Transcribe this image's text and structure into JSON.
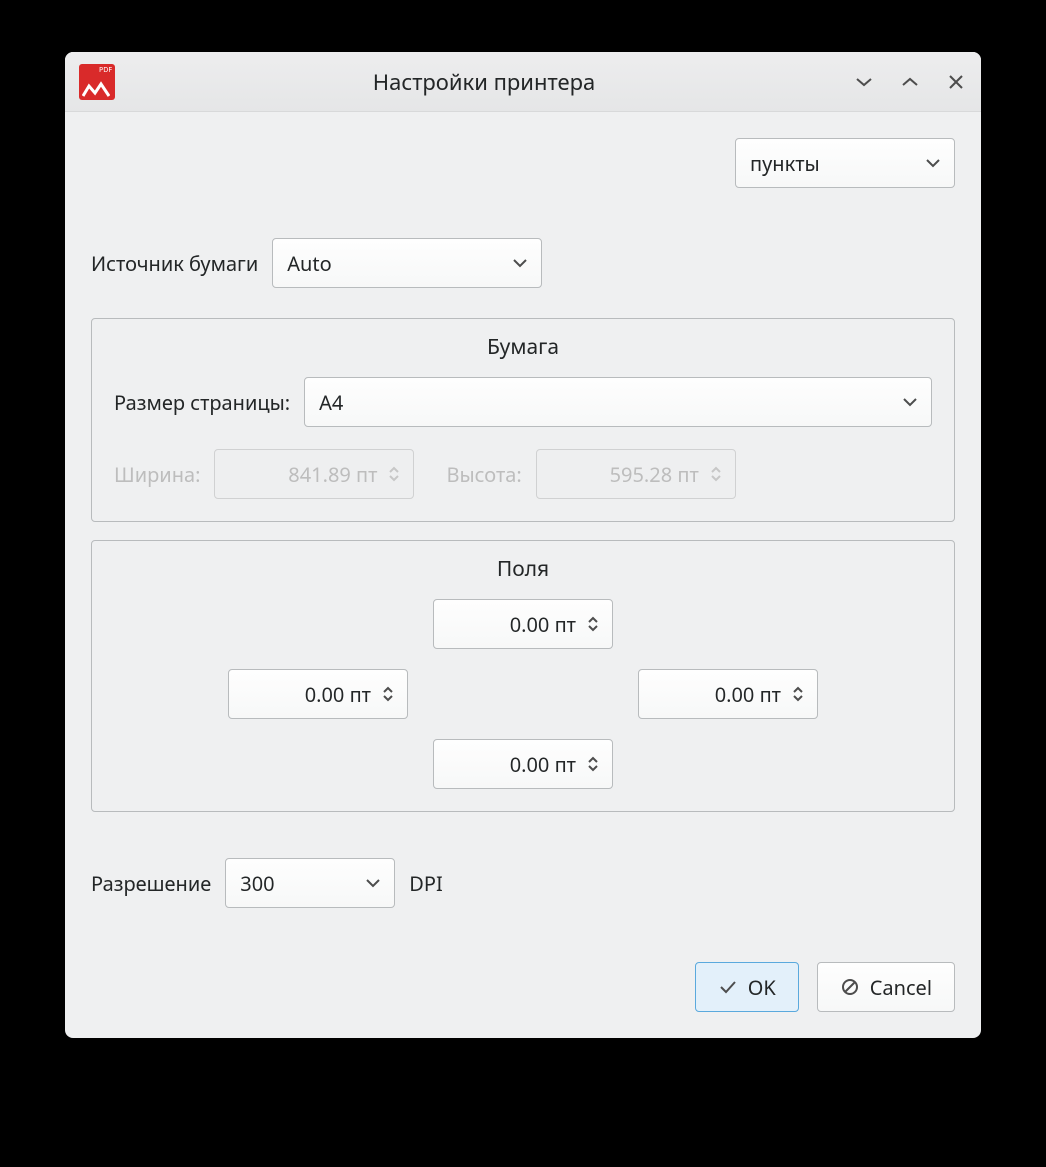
{
  "window": {
    "title": "Настройки принтера"
  },
  "units": {
    "selected": "пункты"
  },
  "paper_source": {
    "label": "Источник бумаги",
    "value": "Auto"
  },
  "paper_group": {
    "title": "Бумага",
    "page_size_label": "Размер страницы:",
    "page_size_value": "A4",
    "width_label": "Ширина:",
    "width_value": "841.89 пт",
    "height_label": "Высота:",
    "height_value": "595.28 пт"
  },
  "margins_group": {
    "title": "Поля",
    "top": "0.00 пт",
    "left": "0.00 пт",
    "right": "0.00 пт",
    "bottom": "0.00 пт"
  },
  "resolution": {
    "label": "Разрешение",
    "value": "300",
    "unit": "DPI"
  },
  "buttons": {
    "ok": "OK",
    "cancel": "Cancel"
  }
}
